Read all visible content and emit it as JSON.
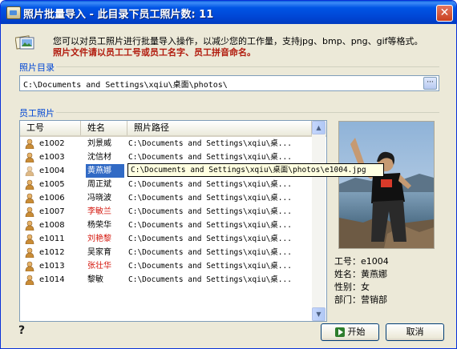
{
  "window": {
    "title": "照片批量导入 - 此目录下员工照片数: 11",
    "close_label": "✕"
  },
  "description": {
    "line1": "您可以对员工照片进行批量导入操作，以减少您的工作量，支持jpg、bmp、png、gif等格式。",
    "line2": "照片文件请以员工工号或员工名字、员工拼音命名。"
  },
  "photo_dir": {
    "label": "照片目录",
    "value": "C:\\Documents and Settings\\xqiu\\桌面\\photos\\",
    "browse_label": "···"
  },
  "employee_photos": {
    "label": "员工照片",
    "columns": [
      "工号",
      "姓名",
      "照片路径"
    ],
    "rows": [
      {
        "id": "e1002",
        "name": "刘景威",
        "path": "C:\\Documents and Settings\\xqiu\\桌...",
        "red": false
      },
      {
        "id": "e1003",
        "name": "沈信材",
        "path": "C:\\Documents and Settings\\xqiu\\桌...",
        "red": false
      },
      {
        "id": "e1004",
        "name": "黄燕娜",
        "path": "C:\\Documents and Settings\\xqiu\\桌...",
        "red": false,
        "selected": true
      },
      {
        "id": "e1005",
        "name": "周正斌",
        "path": "C:\\Documents and Settings\\xqiu\\桌...",
        "red": false
      },
      {
        "id": "e1006",
        "name": "冯晓波",
        "path": "C:\\Documents and Settings\\xqiu\\桌...",
        "red": false
      },
      {
        "id": "e1007",
        "name": "李敏兰",
        "path": "C:\\Documents and Settings\\xqiu\\桌...",
        "red": true
      },
      {
        "id": "e1008",
        "name": "杨荣华",
        "path": "C:\\Documents and Settings\\xqiu\\桌...",
        "red": false
      },
      {
        "id": "e1011",
        "name": "刘艳黎",
        "path": "C:\\Documents and Settings\\xqiu\\桌...",
        "red": true
      },
      {
        "id": "e1012",
        "name": "吴家育",
        "path": "C:\\Documents and Settings\\xqiu\\桌...",
        "red": false
      },
      {
        "id": "e1013",
        "name": "张壮华",
        "path": "C:\\Documents and Settings\\xqiu\\桌...",
        "red": true
      },
      {
        "id": "e1014",
        "name": "黎敏",
        "path": "C:\\Documents and Settings\\xqiu\\桌...",
        "red": false
      }
    ],
    "tooltip": "C:\\Documents and Settings\\xqiu\\桌面\\photos\\e1004.jpg"
  },
  "details": {
    "id": "工号：e1004",
    "name": "姓名：黄燕娜",
    "gender": "性别：女",
    "department": "部门：营销部"
  },
  "buttons": {
    "help": "?",
    "start": "开始",
    "cancel": "取消"
  },
  "colors": {
    "title_bar": "#0055e5",
    "selection": "#316ac5",
    "warning_text": "#b11a0d",
    "red_name": "#d4170d"
  }
}
